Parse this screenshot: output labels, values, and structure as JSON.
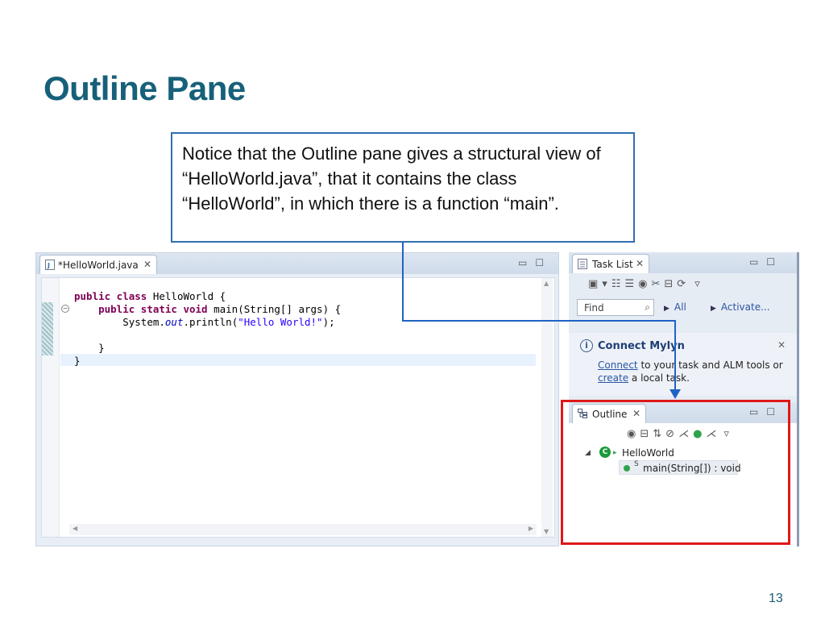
{
  "slide": {
    "title": "Outline Pane",
    "callout": "Notice that the Outline pane gives a structural view of “HelloWorld.java”, that it contains the class “HelloWorld”, in which there is a function “main”.",
    "page_number": "13"
  },
  "editor": {
    "tab_label": "*HelloWorld.java",
    "code": {
      "l1_kw": "public class",
      "l1_rest": " HelloWorld {",
      "l2_kw": "public static void",
      "l2_rest": " main(String[] args) {",
      "l3_pre": "System.",
      "l3_field": "out",
      "l3_mid": ".println(",
      "l3_str": "\"Hello World!\"",
      "l3_end": ");",
      "l4": "}",
      "l5": "}"
    }
  },
  "task_list": {
    "tab_label": "Task List",
    "find_placeholder": "Find",
    "all_label": "All",
    "activate_label": "Activate..."
  },
  "mylyn": {
    "title": "Connect Mylyn",
    "connect_link": "Connect",
    "line1_rest": " to your task and ALM tools or",
    "create_link": "create",
    "line2_rest": " a local task."
  },
  "outline": {
    "tab_label": "Outline",
    "class_node": "HelloWorld",
    "method_node": "main(String[]) : void",
    "static_marker": "S"
  },
  "colors": {
    "title": "#17607a",
    "callout_border": "#2f6fb3",
    "highlight_box": "#e01818",
    "connector": "#1f63c4"
  }
}
